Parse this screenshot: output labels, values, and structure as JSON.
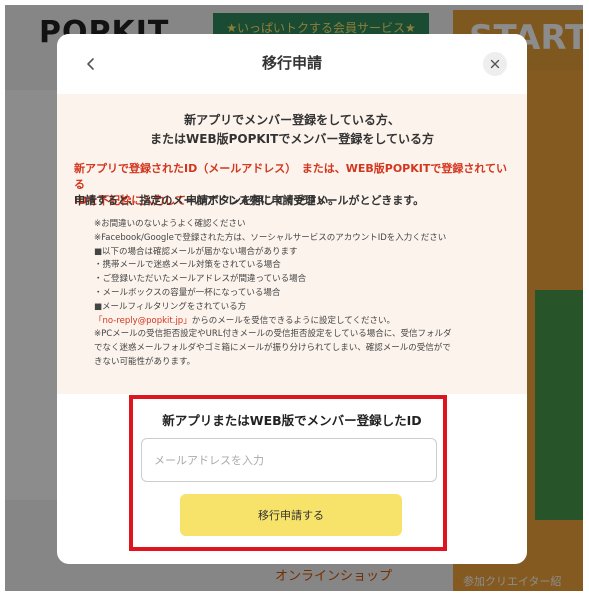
{
  "background": {
    "logo": "POPKIT",
    "banner": "★いっぱいトクする会員サービス★",
    "start": "START",
    "footer_link": "オンラインショップ",
    "footer_right": "参加クリエイター紹"
  },
  "modal": {
    "title": "移行申請",
    "info": {
      "heading_line1": "新アプリでメンバー登録をしている方、",
      "heading_line2": "またはWEB版POPKITでメンバー登録をしている方",
      "red_line1": "新アプリで登録されたID（メールアドレス）　または、WEB版POPKITで登録されている",
      "red_line2_red": "IDを下記枠に入力して",
      "red_line2_black": "申請ボタンを押してください。",
      "main_line": "申請すると、指定のメールアドレス宛に申請受理メールがとどきます。",
      "notes": [
        "※お間違いのないようよく確認ください",
        "※Facebook/Googleで登録された方は、ソーシャルサービスのアカウントIDを入力ください",
        "■以下の場合は確認メールが届かない場合があります",
        "・携帯メールで迷惑メール対策をされている場合",
        "・ご登録いただいたメールアドレスが間違っている場合",
        "・メールボックスの容量が一杯になっている場合",
        "■メールフィルタリングをされている方"
      ],
      "noreply_address": "「no-reply@popkit.jp」",
      "noreply_suffix": "からのメールを受信できるように設定してください。",
      "notes_tail": [
        "※PCメールの受信拒否設定やURL付きメールの受信拒否設定をしている場合に、受信フォルダ",
        "でなく迷惑メールフォルダやゴミ箱にメールが振り分けられてしまい、確認メールの受信がで",
        "きない可能性があります。"
      ]
    },
    "form": {
      "label": "新アプリまたはWEB版でメンバー登録したID",
      "email_placeholder": "メールアドレスを入力",
      "email_value": "",
      "submit_label": "移行申請する"
    }
  },
  "colors": {
    "accent_red": "#d3361f",
    "button_yellow": "#f7e26a",
    "info_bg": "#fcf3ec",
    "highlight": "#e0141d"
  },
  "icons": {
    "back": "chevron-left-icon",
    "close": "close-icon"
  }
}
